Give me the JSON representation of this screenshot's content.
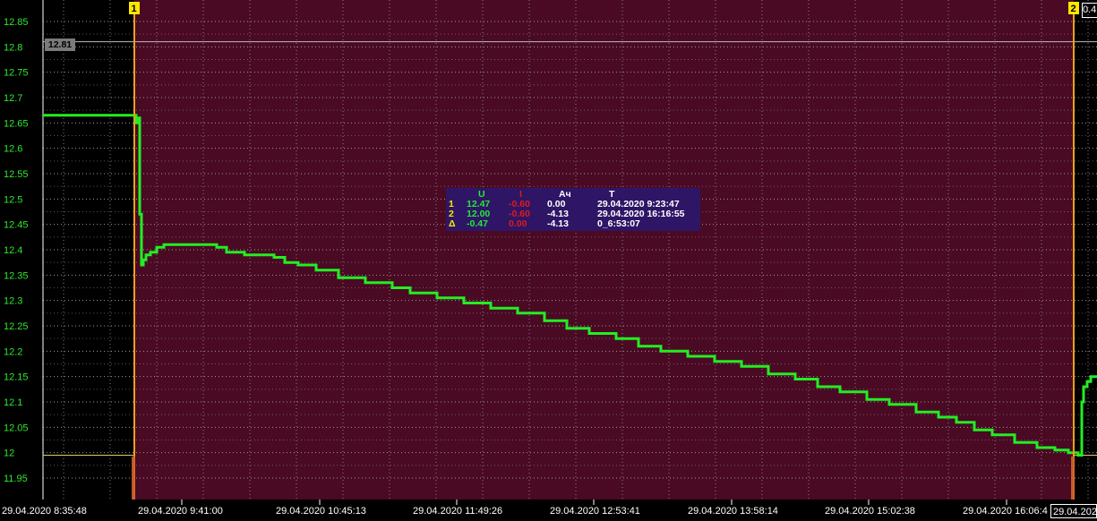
{
  "chart_data": {
    "type": "line",
    "ylim": [
      11.92,
      12.87
    ],
    "y_ticks": [
      12.85,
      12.8,
      12.75,
      12.7,
      12.65,
      12.6,
      12.55,
      12.5,
      12.45,
      12.4,
      12.35,
      12.3,
      12.25,
      12.2,
      12.15,
      12.1,
      12.05,
      12,
      11.95
    ],
    "y_tick_labels": [
      "12.85",
      "12.8",
      "12.75",
      "12.7",
      "12.65",
      "12.6",
      "12.55",
      "12.5",
      "12.45",
      "12.4",
      "12.35",
      "12.3",
      "12.25",
      "12.2",
      "12.15",
      "12.1",
      "12.05",
      "12",
      "11.95"
    ],
    "x_tick_labels": [
      "29.04.2020 8:35:48",
      "29.04.2020 9:41:00",
      "29.04.2020 10:45:13",
      "29.04.2020 11:49:26",
      "29.04.2020 12:53:41",
      "29.04.2020 13:58:14",
      "29.04.2020 15:02:38",
      "29.04.2020 16:06:4"
    ],
    "grid": true,
    "cursor_price": "12.81",
    "cursor_value": 12.81,
    "level_line_value": 11.995,
    "series": [
      {
        "values": [
          [
            0,
            12.665
          ],
          [
            0.102,
            12.665
          ],
          [
            0.104,
            12.65
          ],
          [
            0.106,
            12.66
          ],
          [
            0.108,
            12.47
          ],
          [
            0.11,
            12.37
          ],
          [
            0.112,
            12.38
          ],
          [
            0.115,
            12.39
          ],
          [
            0.12,
            12.395
          ],
          [
            0.127,
            12.405
          ],
          [
            0.135,
            12.41
          ],
          [
            0.162,
            12.41
          ],
          [
            0.186,
            12.41
          ],
          [
            0.194,
            12.405
          ],
          [
            0.205,
            12.395
          ],
          [
            0.225,
            12.39
          ],
          [
            0.258,
            12.385
          ],
          [
            0.27,
            12.375
          ],
          [
            0.285,
            12.37
          ],
          [
            0.305,
            12.36
          ],
          [
            0.33,
            12.345
          ],
          [
            0.36,
            12.335
          ],
          [
            0.39,
            12.325
          ],
          [
            0.41,
            12.315
          ],
          [
            0.44,
            12.305
          ],
          [
            0.47,
            12.295
          ],
          [
            0.5,
            12.285
          ],
          [
            0.53,
            12.275
          ],
          [
            0.56,
            12.26
          ],
          [
            0.585,
            12.245
          ],
          [
            0.61,
            12.235
          ],
          [
            0.64,
            12.225
          ],
          [
            0.665,
            12.21
          ],
          [
            0.69,
            12.2
          ],
          [
            0.72,
            12.19
          ],
          [
            0.75,
            12.18
          ],
          [
            0.78,
            12.17
          ],
          [
            0.81,
            12.155
          ],
          [
            0.84,
            12.145
          ],
          [
            0.865,
            12.13
          ],
          [
            0.89,
            12.12
          ],
          [
            0.92,
            12.105
          ],
          [
            0.945,
            12.095
          ],
          [
            0.975,
            12.08
          ],
          [
            1.0,
            12.07
          ],
          [
            1.02,
            12.06
          ],
          [
            1.04,
            12.045
          ],
          [
            1.06,
            12.035
          ],
          [
            1.085,
            12.02
          ],
          [
            1.11,
            12.01
          ],
          [
            1.13,
            12.005
          ],
          [
            1.145,
            12.0
          ],
          [
            1.156,
            11.995
          ],
          [
            1.16,
            12.1
          ],
          [
            1.162,
            12.13
          ],
          [
            1.166,
            12.14
          ],
          [
            1.17,
            12.15
          ],
          [
            1.18,
            12.155
          ],
          [
            1.195,
            12.16
          ],
          [
            1.21,
            12.17
          ],
          [
            1.22,
            12.175
          ],
          [
            1.24,
            12.18
          ],
          [
            1.27,
            12.185
          ],
          [
            1.285,
            12.19
          ]
        ]
      }
    ]
  },
  "markers": [
    {
      "label": "1",
      "x_frac": 0.102
    },
    {
      "label": "2",
      "x_frac": 1.151
    }
  ],
  "info_table": {
    "headers": {
      "u": "U",
      "i": "I",
      "ah": "Ач",
      "t": "T"
    },
    "rows": [
      {
        "key": "1",
        "u": "12.47",
        "i": "-0.60",
        "ah": "0.00",
        "t": "29.04.2020 9:23:47"
      },
      {
        "key": "2",
        "u": "12.00",
        "i": "-0.60",
        "ah": "-4.13",
        "t": "29.04.2020 16:16:55"
      },
      {
        "key": "Δ",
        "u": "-0.47",
        "i": "0.00",
        "ah": "-4.13",
        "t": "0_6:53:07"
      }
    ]
  },
  "corner_top_right": "0.4",
  "corner_bottom_right": "29.04.202",
  "colors": {
    "selection_bg": "#4a0a24",
    "series": "#22ee22",
    "marker": "#e8a21a",
    "marker_label_bg": "#ffe600",
    "grid": "#9a9a9a",
    "level_line": "#e8c870"
  }
}
